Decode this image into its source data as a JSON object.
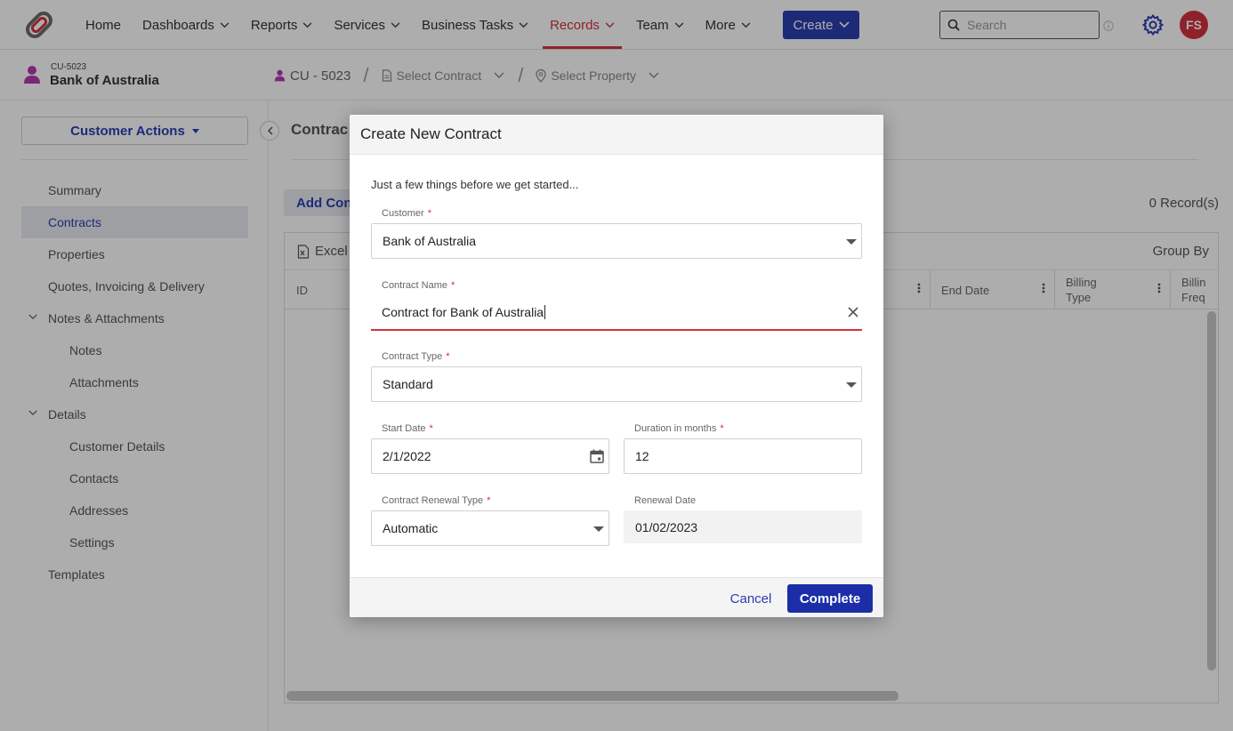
{
  "nav": {
    "items": [
      {
        "label": "Home",
        "dropdown": false,
        "active": false
      },
      {
        "label": "Dashboards",
        "dropdown": true,
        "active": false
      },
      {
        "label": "Reports",
        "dropdown": true,
        "active": false
      },
      {
        "label": "Services",
        "dropdown": true,
        "active": false
      },
      {
        "label": "Business Tasks",
        "dropdown": true,
        "active": false
      },
      {
        "label": "Records",
        "dropdown": true,
        "active": true
      },
      {
        "label": "Team",
        "dropdown": true,
        "active": false
      },
      {
        "label": "More",
        "dropdown": true,
        "active": false
      }
    ],
    "create_label": "Create",
    "search_placeholder": "Search",
    "avatar_initials": "FS",
    "accent_color": "#d3313f",
    "primary_color": "#2b3eb1"
  },
  "subheader": {
    "customer_code": "CU-5023",
    "customer_name": "Bank of Australia",
    "crumb_customer": "CU - 5023",
    "crumb_contract": "Select Contract",
    "crumb_property": "Select Property"
  },
  "sidebar": {
    "actions_label": "Customer Actions",
    "items": [
      {
        "label": "Summary",
        "level": 0,
        "active": false,
        "expander": false
      },
      {
        "label": "Contracts",
        "level": 0,
        "active": true,
        "expander": false
      },
      {
        "label": "Properties",
        "level": 0,
        "active": false,
        "expander": false
      },
      {
        "label": "Quotes, Invoicing & Delivery",
        "level": 0,
        "active": false,
        "expander": false
      },
      {
        "label": "Notes & Attachments",
        "level": 0,
        "active": false,
        "expander": true
      },
      {
        "label": "Notes",
        "level": 1,
        "active": false,
        "expander": false
      },
      {
        "label": "Attachments",
        "level": 1,
        "active": false,
        "expander": false
      },
      {
        "label": "Details",
        "level": 0,
        "active": false,
        "expander": true
      },
      {
        "label": "Customer Details",
        "level": 1,
        "active": false,
        "expander": false
      },
      {
        "label": "Contacts",
        "level": 1,
        "active": false,
        "expander": false
      },
      {
        "label": "Addresses",
        "level": 1,
        "active": false,
        "expander": false
      },
      {
        "label": "Settings",
        "level": 1,
        "active": false,
        "expander": false
      },
      {
        "label": "Templates",
        "level": 0,
        "active": false,
        "expander": false
      }
    ]
  },
  "main": {
    "title": "Contrac",
    "add_label": "Add Con",
    "records_count": "0 Record(s)",
    "excel_label": "Excel",
    "group_by_label": "Group By",
    "columns": {
      "id": "ID",
      "end_date": "End Date",
      "billing_type_1": "Billing",
      "billing_type_2": "Type",
      "billing_freq_1": "Billin",
      "billing_freq_2": "Freq"
    }
  },
  "modal": {
    "title": "Create New Contract",
    "intro": "Just a few things before we get started...",
    "customer": {
      "label": "Customer",
      "value": "Bank of Australia"
    },
    "contract_name": {
      "label": "Contract Name",
      "value": "Contract for Bank of Australia"
    },
    "contract_type": {
      "label": "Contract Type",
      "value": "Standard"
    },
    "start_date": {
      "label": "Start Date",
      "value": "2/1/2022"
    },
    "duration": {
      "label": "Duration in months",
      "value": "12"
    },
    "renewal_type": {
      "label": "Contract Renewal Type",
      "value": "Automatic"
    },
    "renewal_date": {
      "label": "Renewal Date",
      "value": "01/02/2023"
    },
    "cancel_label": "Cancel",
    "complete_label": "Complete"
  }
}
